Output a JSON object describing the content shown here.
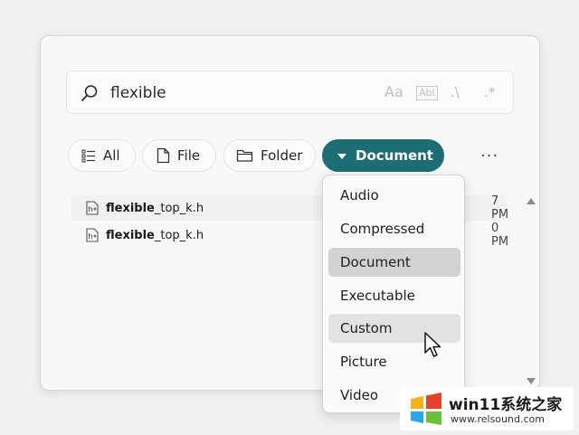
{
  "search": {
    "value": "flexible",
    "options": {
      "match_case": "Aa",
      "whole_word": "Abl",
      "match_path": ".\\",
      "regex": ".*"
    }
  },
  "filters": {
    "all": "All",
    "file": "File",
    "folder": "Folder",
    "document": "Document",
    "more": "···"
  },
  "results": [
    {
      "name_bold": "flexible",
      "name_rest": "_top_k.h",
      "time": "7 PM"
    },
    {
      "name_bold": "flexible",
      "name_rest": "_top_k.h",
      "time": "0 PM"
    }
  ],
  "dropdown": {
    "items": [
      "Audio",
      "Compressed",
      "Document",
      "Executable",
      "Custom",
      "Picture",
      "Video"
    ],
    "selected": "Document",
    "hovered": "Custom"
  },
  "watermark": {
    "title": "win11系统之家",
    "url": "www.relsound.com"
  },
  "colors": {
    "accent": "#1d6d74"
  }
}
